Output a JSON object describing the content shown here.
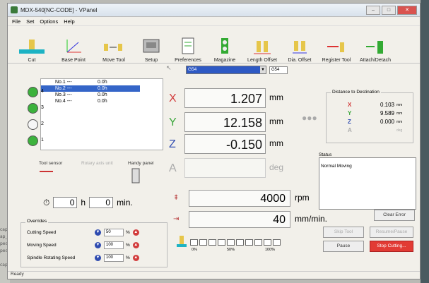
{
  "window": {
    "title": "MDX-540[NC-CODE] - VPanel"
  },
  "menu": [
    "File",
    "Set",
    "Options",
    "Help"
  ],
  "toolbar": [
    {
      "label": "Cut",
      "icon": "cut-icon"
    },
    {
      "label": "Base Point",
      "icon": "base-point-icon"
    },
    {
      "label": "Move Tool",
      "icon": "move-tool-icon"
    },
    {
      "label": "Setup",
      "icon": "setup-icon"
    },
    {
      "label": "Preferences",
      "icon": "preferences-icon"
    },
    {
      "label": "Magazine",
      "icon": "magazine-icon"
    },
    {
      "label": "Length Offset",
      "icon": "length-offset-icon"
    },
    {
      "label": "Dia. Offset",
      "icon": "dia-offset-icon"
    },
    {
      "label": "Register Tool",
      "icon": "register-tool-icon"
    },
    {
      "label": "Attach/Detach",
      "icon": "attach-detach-icon"
    }
  ],
  "tools": [
    {
      "name": "No.1 ---",
      "value": "0.0h"
    },
    {
      "name": "No.2 ---",
      "value": "0.0h"
    },
    {
      "name": "No.3 ---",
      "value": "0.0h"
    },
    {
      "name": "No.4 ---",
      "value": "0.0h"
    }
  ],
  "magazine": {
    "slots": [
      "4",
      "3",
      "2",
      "1"
    ]
  },
  "sensors": {
    "tool_sensor": "Tool sensor",
    "rotary": "Rotary axis unit",
    "handy": "Handy panel"
  },
  "time": {
    "hours": "0",
    "h_label": "h",
    "minutes": "0",
    "min_label": "min."
  },
  "overrides": {
    "title": "Overrides",
    "rows": [
      {
        "label": "Cutting Speed",
        "value": "50",
        "unit": "%"
      },
      {
        "label": "Moving Speed",
        "value": "100",
        "unit": "%"
      },
      {
        "label": "Spindle Rotating Speed",
        "value": "100",
        "unit": "%"
      }
    ]
  },
  "coord": {
    "system": "G54",
    "system2": "G54"
  },
  "axes": [
    {
      "name": "X",
      "value": "1.207",
      "unit": "mm",
      "color": "#d23c3c"
    },
    {
      "name": "Y",
      "value": "12.158",
      "unit": "mm",
      "color": "#3aa63a"
    },
    {
      "name": "Z",
      "value": "-0.150",
      "unit": "mm",
      "color": "#2f4bb0"
    },
    {
      "name": "A",
      "value": "",
      "unit": "deg",
      "color": "#aaaaaa"
    }
  ],
  "spindle": {
    "value": "4000",
    "unit": "rpm"
  },
  "feed": {
    "value": "40",
    "unit": "mm/min."
  },
  "progress": {
    "ticks": [
      "0%",
      "50%",
      "100%"
    ],
    "fraction": 0.0
  },
  "distance": {
    "title": "Distance to Destination",
    "rows": [
      {
        "axis": "X",
        "value": "0.103",
        "unit": "mm",
        "color": "#d23c3c"
      },
      {
        "axis": "Y",
        "value": "9.589",
        "unit": "mm",
        "color": "#3aa63a"
      },
      {
        "axis": "Z",
        "value": "0.000",
        "unit": "mm",
        "color": "#2f4bb0"
      },
      {
        "axis": "A",
        "value": "",
        "unit": "deg",
        "color": "#aaaaaa"
      }
    ]
  },
  "status": {
    "label": "Status",
    "text": "Normal Moving"
  },
  "buttons": {
    "clear_error": "Clear Error",
    "skip": "Skip Tool",
    "resume": "Resume/Pause",
    "pause": "Pause",
    "stop": "Stop Cutting..."
  },
  "statusbar": "Ready"
}
